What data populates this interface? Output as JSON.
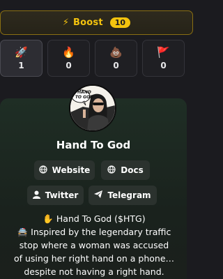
{
  "boost": {
    "icon": "lightning-icon",
    "label": "Boost",
    "count": "10"
  },
  "reactions": [
    {
      "icon": "rocket-icon",
      "emoji": "🚀",
      "count": "1",
      "active": true
    },
    {
      "icon": "fire-icon",
      "emoji": "🔥",
      "count": "0",
      "active": false
    },
    {
      "icon": "poop-icon",
      "emoji": "💩",
      "count": "0",
      "active": false
    },
    {
      "icon": "red-flag-icon",
      "emoji": "🚩",
      "count": "0",
      "active": false
    }
  ],
  "token": {
    "name": "Hand To God",
    "avatar_text": "HAND TO GOD",
    "links": {
      "website": "Website",
      "docs": "Docs",
      "twitter": "Twitter",
      "telegram": "Telegram"
    },
    "ticker_line": "✋ Hand To God ($HTG)",
    "description_lines": [
      "🚔 Inspired by the legendary traffic",
      "stop where a woman was accused",
      "of using her right hand on a phone…",
      "despite not having a right hand."
    ]
  },
  "colors": {
    "accent": "#f4c30e",
    "card_top": "#1f2e25",
    "background": "#1b1b1f"
  }
}
